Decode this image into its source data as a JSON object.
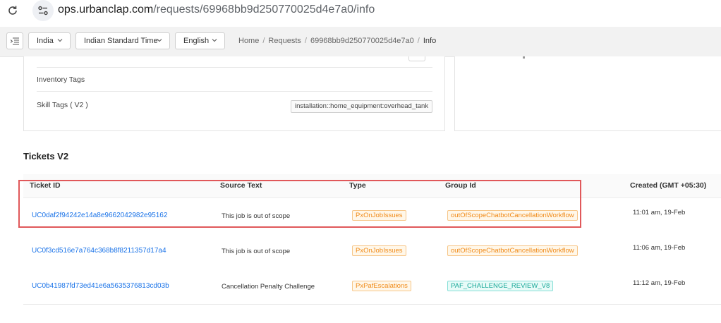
{
  "browser": {
    "url_host": "ops.urbanclap.com",
    "url_path": "/requests/69968bb9d250770025d4e7a0/info"
  },
  "header": {
    "country": "India",
    "timezone": "Indian Standard Time",
    "language": "English",
    "breadcrumb": [
      "Home",
      "Requests",
      "69968bb9d250770025d4e7a0",
      "Info"
    ]
  },
  "details": {
    "inventory_tags_label": "Inventory Tags",
    "skill_tags_label": "Skill Tags ( V2 )",
    "skill_tag_value": "installation::home_equipment:overhead_tank"
  },
  "tickets": {
    "title": "Tickets V2",
    "columns": {
      "ticket_id": "Ticket ID",
      "source_text": "Source Text",
      "type": "Type",
      "group_id": "Group Id",
      "created": "Created (GMT +05:30)"
    },
    "rows": [
      {
        "ticket_id": "UC0daf2f94242e14a8e9662042982e95162",
        "source_text": "This job is out of scope",
        "type": "PxOnJobIssues",
        "group_id": "outOfScopeChatbotCancellationWorkflow",
        "created": "11:01 am, 19-Feb"
      },
      {
        "ticket_id": "UC0f3cd516e7a764c368b8f8211357d17a4",
        "source_text": "This job is out of scope",
        "type": "PxOnJobIssues",
        "group_id": "outOfScopeChatbotCancellationWorkflow",
        "created": "11:06 am, 19-Feb"
      },
      {
        "ticket_id": "UC0b41987fd73ed41e6a5635376813cd03b",
        "source_text": "Cancellation Penalty Challenge",
        "type": "PxPafEscalations",
        "group_id": "PAF_CHALLENGE_REVIEW_V8",
        "created": "11:12 am, 19-Feb"
      }
    ]
  },
  "colors": {
    "link": "#1a73e8",
    "tag_orange": "#f08a18",
    "tag_teal": "#17a898",
    "highlight": "#e0585a"
  }
}
